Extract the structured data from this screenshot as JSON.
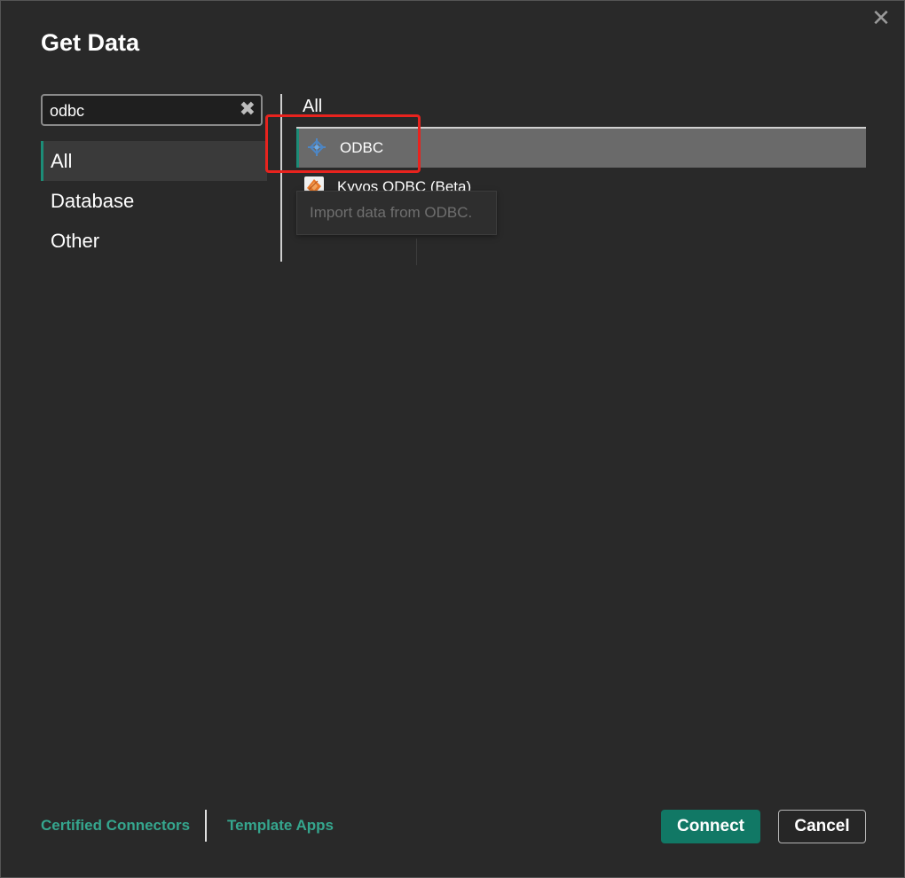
{
  "dialog": {
    "title": "Get Data",
    "close_glyph": "✕"
  },
  "search": {
    "value": "odbc",
    "clear_glyph": "✖"
  },
  "categories": [
    {
      "label": "All",
      "active": true
    },
    {
      "label": "Database",
      "active": false
    },
    {
      "label": "Other",
      "active": false
    }
  ],
  "results": {
    "section_title": "All",
    "items": [
      {
        "label": "ODBC",
        "icon": "odbc-icon",
        "selected": true
      },
      {
        "label": "Kyvos ODBC (Beta)",
        "icon": "kyvos-icon",
        "selected": false
      }
    ],
    "tooltip": "Import data from ODBC."
  },
  "footer": {
    "certified_link": "Certified Connectors",
    "template_link": "Template Apps",
    "connect_label": "Connect",
    "cancel_label": "Cancel"
  },
  "colors": {
    "accent": "#117865",
    "link": "#35a68e",
    "highlight_box": "#e8231e"
  }
}
